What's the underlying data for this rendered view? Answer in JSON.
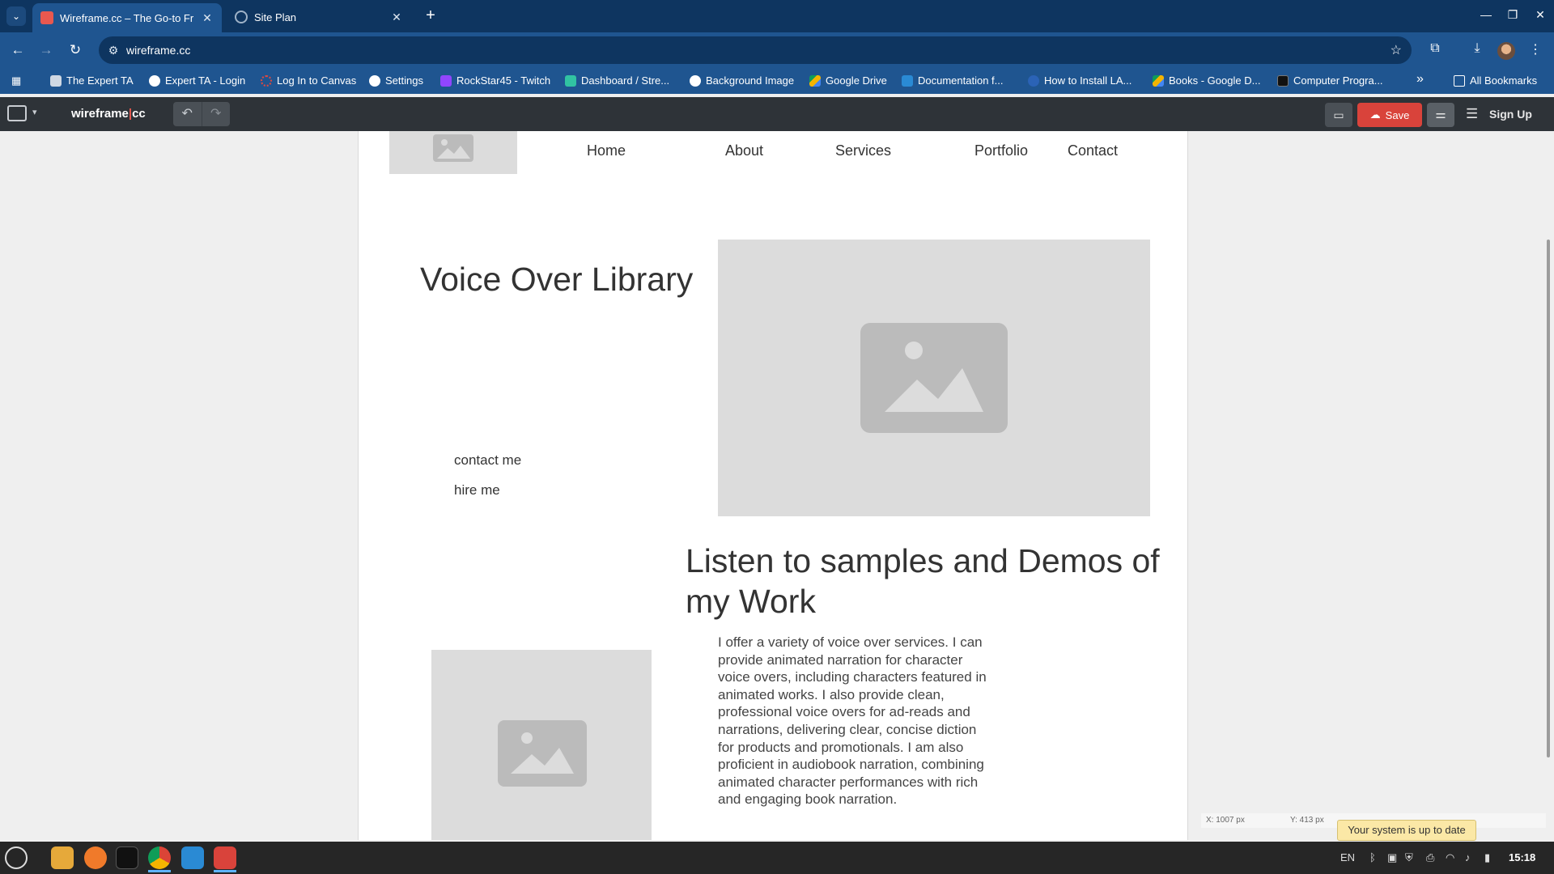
{
  "browser": {
    "tabs": [
      {
        "title": "Wireframe.cc – The Go-to Fr",
        "active": true
      },
      {
        "title": "Site Plan",
        "active": false
      }
    ],
    "url": "wireframe.cc",
    "bookmarks": [
      "The Expert TA",
      "Expert TA - Login",
      "Log In to Canvas",
      "Settings",
      "RockStar45 - Twitch",
      "Dashboard / Stre...",
      "Background Image",
      "Google Drive",
      "Documentation f...",
      "How to Install LA...",
      "Books - Google D...",
      "Computer Progra..."
    ],
    "more_label": "»",
    "all_bookmarks": "All Bookmarks"
  },
  "app": {
    "brand_left": "wireframe",
    "brand_pipe": "|",
    "brand_right": "cc",
    "save_label": "Save",
    "signup_label": "Sign Up"
  },
  "wireframe": {
    "nav": [
      "Home",
      "About",
      "Services",
      "Portfolio",
      "Contact"
    ],
    "hero_title": "Voice Over Library",
    "links": [
      "contact me",
      "hire me"
    ],
    "section_title": "Listen to samples and Demos of my Work",
    "paragraph": "I offer a variety of voice over services. I can provide animated narration for character voice overs, including characters featured in animated works. I also provide clean, professional voice overs for ad-reads and narrations, delivering clear, concise diction for products and promotionals. I am also proficient in audiobook narration, combining animated character performances with rich and engaging book narration."
  },
  "status": {
    "x_readout": "X: 1007 px",
    "y_readout": "Y: 413 px",
    "toast": "Your system is up to date"
  },
  "taskbar": {
    "lang": "EN",
    "time": "15:18"
  },
  "colors": {
    "tabbar": "#0e3560",
    "toolbar": "#1f5590",
    "app_toolbar": "#2e3338",
    "save": "#d9433b",
    "placeholder": "#dcdcdc"
  }
}
